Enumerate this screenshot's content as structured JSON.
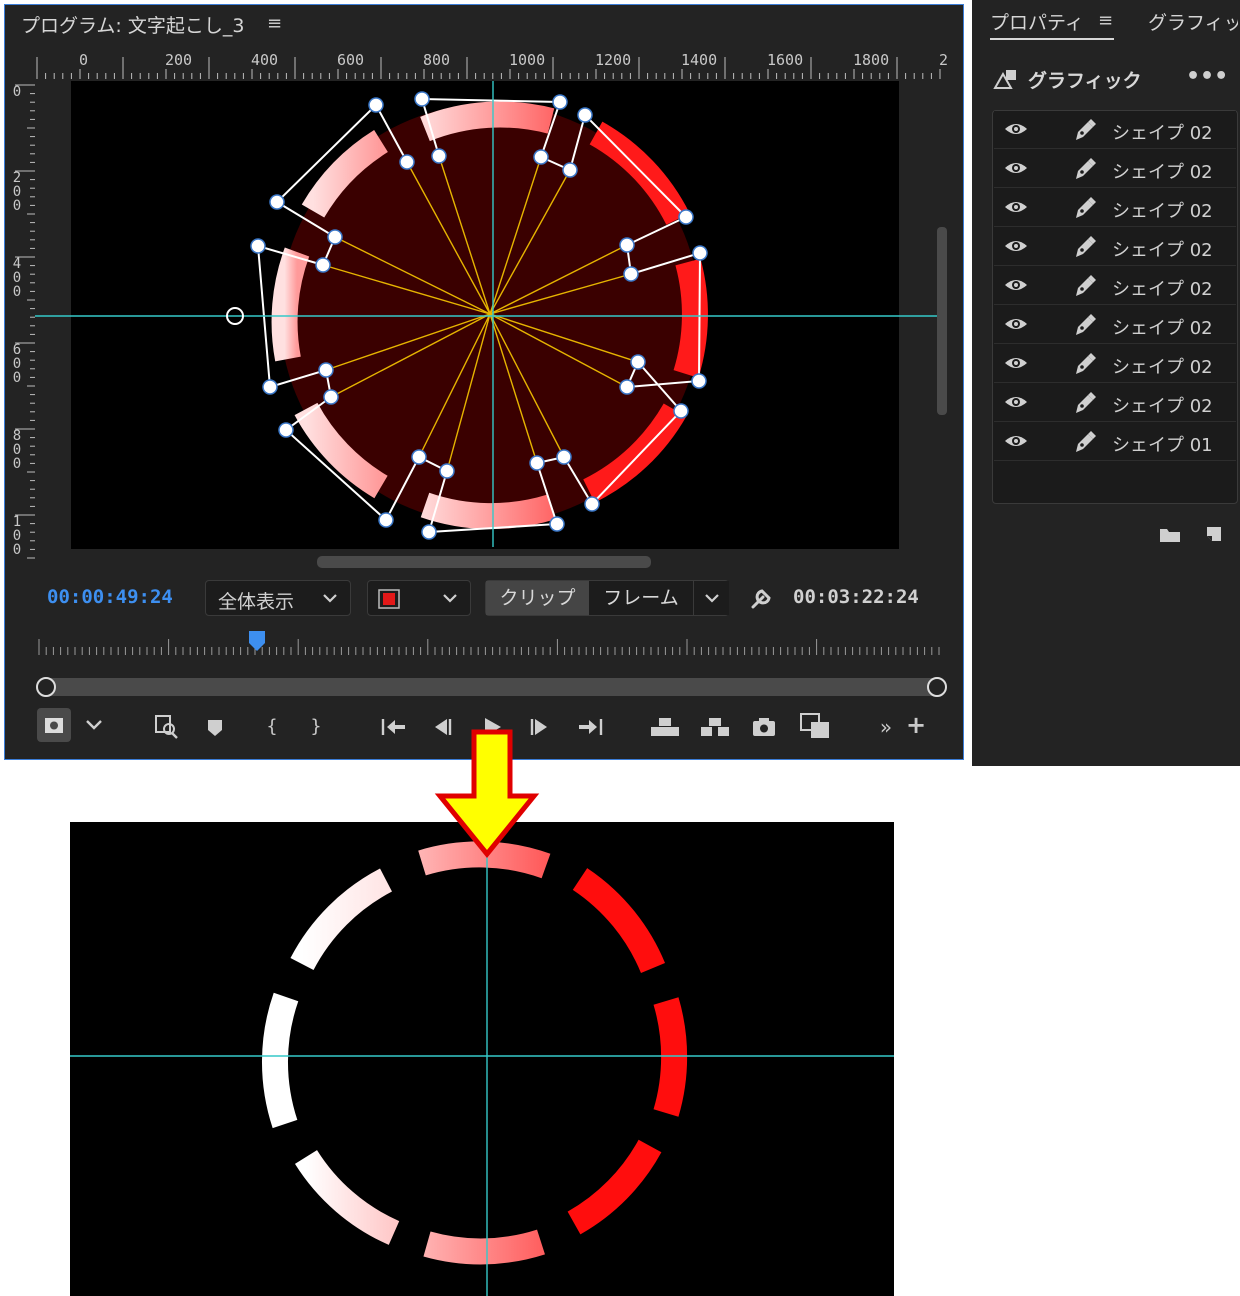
{
  "program_panel": {
    "title": "プログラム: 文字起こし_3",
    "menu_icon": "hamburger-icon",
    "ruler_labels": [
      "0",
      "200",
      "400",
      "600",
      "800",
      "1000",
      "1200",
      "1400",
      "1600",
      "1800",
      "2"
    ],
    "vruler_labels": [
      "0",
      "200",
      "400",
      "600",
      "800",
      "100"
    ],
    "current_timecode": "00:00:49:24",
    "zoom_select": "全体表示",
    "quality_select_icon": "record-icon",
    "segment_clip": "クリップ",
    "segment_frame": "フレーム",
    "settings_icon": "wrench-icon",
    "duration_timecode": "00:03:22:24",
    "colors": {
      "accent": "#3d8ff0",
      "guide": "#35c9c9",
      "shape_red": "#ff1a1a",
      "shape_dark": "#3a0000",
      "path_line": "#e6b400"
    }
  },
  "properties_panel": {
    "tab_properties": "プロパティ",
    "tab_graphics": "グラフィッ",
    "section_title": "グラフィック",
    "more_icon": "ellipsis-icon",
    "layers": [
      {
        "label": "シェイプ 02"
      },
      {
        "label": "シェイプ 02"
      },
      {
        "label": "シェイプ 02"
      },
      {
        "label": "シェイプ 02"
      },
      {
        "label": "シェイプ 02"
      },
      {
        "label": "シェイプ 02"
      },
      {
        "label": "シェイプ 02"
      },
      {
        "label": "シェイプ 02"
      },
      {
        "label": "シェイプ 01"
      }
    ]
  },
  "arrow": {
    "color": "#ffff00",
    "outline": "#e00000"
  }
}
